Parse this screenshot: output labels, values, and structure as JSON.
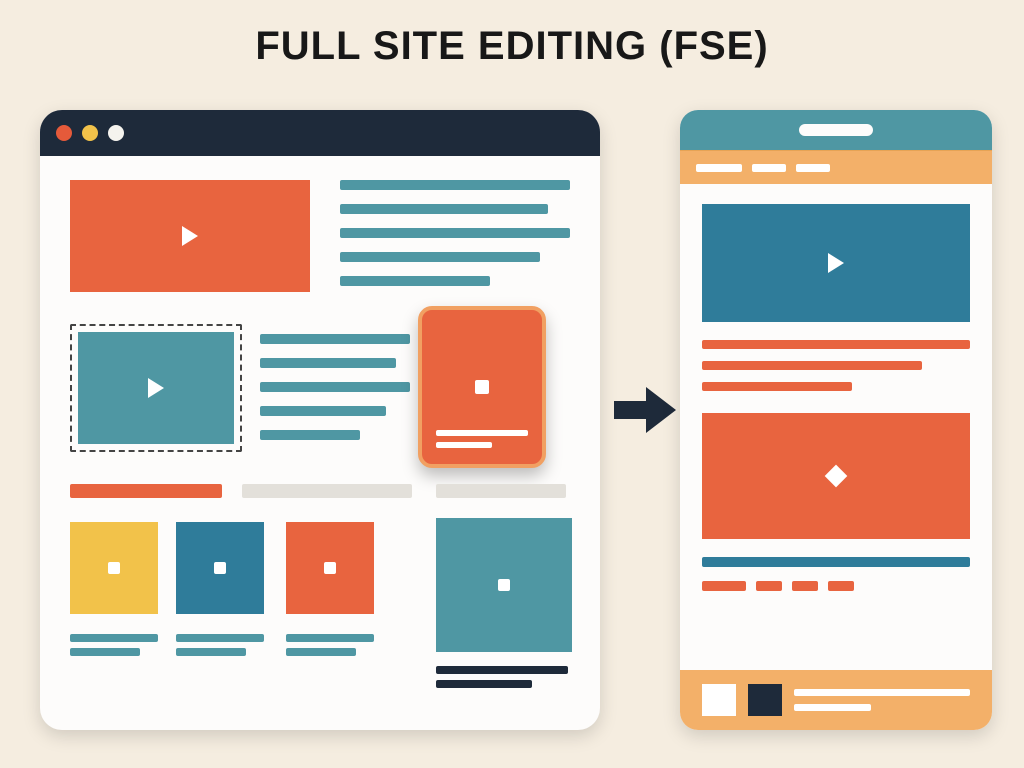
{
  "title": "FULL SITE EDITING (FSE)",
  "colors": {
    "bg": "#f5ede0",
    "dark": "#1e2a3a",
    "orange": "#e8643f",
    "teal": "#4f97a3",
    "teal_dark": "#2f7c9a",
    "yellow": "#f2c24a",
    "peach": "#f3b069",
    "gray": "#e3e0da"
  },
  "browser": {
    "traffic_lights": [
      "red",
      "yellow",
      "white"
    ],
    "hero_block": {
      "type": "video",
      "color": "orange"
    },
    "hero_text_lines": 5,
    "selected_block": {
      "type": "video",
      "color": "teal",
      "state": "selected-dashed"
    },
    "mid_text_lines": 5,
    "floating_card": {
      "color": "orange",
      "border": "peach",
      "caption_lines": 2
    },
    "section_bars": [
      {
        "color": "orange"
      },
      {
        "color": "gray"
      },
      {
        "color": "gray"
      }
    ],
    "thumbnails": [
      {
        "color": "yellow"
      },
      {
        "color": "teal_dark"
      },
      {
        "color": "orange"
      },
      {
        "color": "teal",
        "size": "large"
      }
    ]
  },
  "arrow_direction": "right",
  "mobile": {
    "status_bar_color": "teal",
    "nav_bar_color": "peach",
    "hero_block": {
      "type": "video",
      "color": "teal_dark"
    },
    "text_lines_1": 3,
    "card": {
      "color": "orange",
      "marker": "diamond"
    },
    "text_lines_2": {
      "full_bar": "teal_dark",
      "chips": 4
    },
    "footer": {
      "swatches": [
        "white",
        "dark"
      ],
      "bars": 2
    }
  }
}
